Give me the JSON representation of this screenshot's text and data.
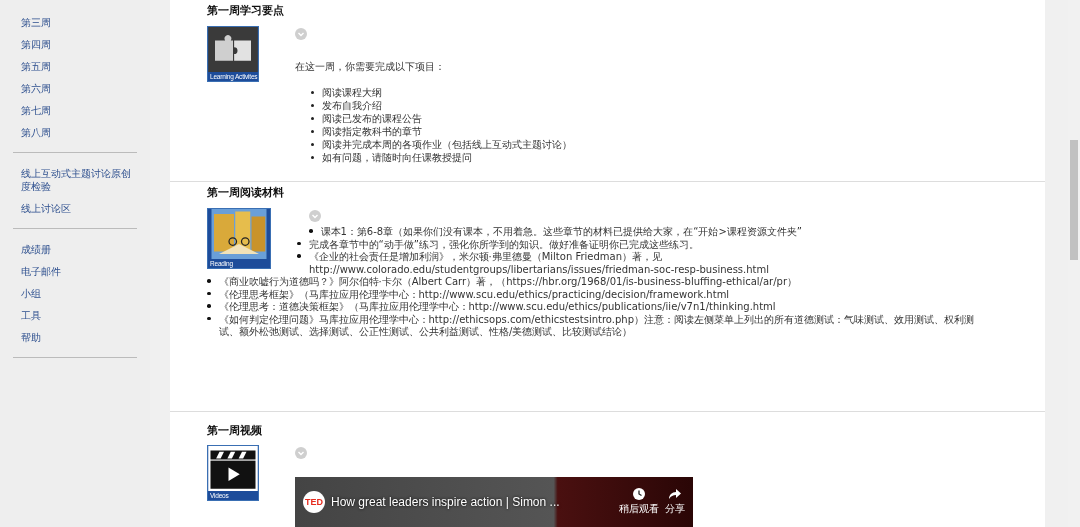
{
  "sidebar": {
    "groups": [
      {
        "items": [
          {
            "label": "第三周"
          },
          {
            "label": "第四周"
          },
          {
            "label": "第五周"
          },
          {
            "label": "第六周"
          },
          {
            "label": "第七周"
          },
          {
            "label": "第八周"
          }
        ]
      },
      {
        "items": [
          {
            "label": "线上互动式主题讨论原创度检验"
          },
          {
            "label": "线上讨论区"
          }
        ]
      },
      {
        "items": [
          {
            "label": "成绩册"
          },
          {
            "label": "电子邮件"
          },
          {
            "label": "小组"
          },
          {
            "label": "工具"
          },
          {
            "label": "帮助"
          }
        ]
      }
    ]
  },
  "sections": [
    {
      "kind": "activities",
      "title": "第一周学习要点",
      "image_label": "Learning Activites",
      "intro": "在这一周，你需要完成以下项目：",
      "items": [
        "阅读课程大纲",
        "发布自我介绍",
        "阅读已发布的课程公告",
        "阅读指定教科书的章节",
        "阅读并完成本周的各项作业（包括线上互动式主题讨论）",
        "如有问题，请随时向任课教授提问"
      ]
    },
    {
      "kind": "reading",
      "title": "第一周阅读材料",
      "image_label": "Reading",
      "items": [
        "课本1：第6-8章（如果你们没有课本，不用着急。这些章节的材料已提供给大家，在“开始>课程资源文件夹”",
        "完成各章节中的“动手做”练习，强化你所学到的知识。做好准备证明你已完成这些练习。",
        "《企业的社会责任是增加利润》，米尔顿·弗里德曼（Milton Friedman）著，见http://www.colorado.edu/studentgroups/libertarians/issues/friedman-soc-resp-business.html",
        "《商业吹嘘行为道德吗？》阿尔伯特·卡尔（Albert Carr）著，（https://hbr.org/1968/01/is-business-bluffing-ethical/ar/pr）",
        "《伦理思考框架》（马库拉应用伦理学中心：http://www.scu.edu/ethics/practicing/decision/framework.html",
        "《伦理思考：道德决策框架》（马库拉应用伦理学中心：http://www.scu.edu/ethics/publications/iie/v7n1/thinking.html",
        "《如何判定伦理问题》马库拉应用伦理学中心：http://ethicsops.com/ethicstestsintro.php）注意：阅读左侧菜单上列出的所有道德测试：气味测试、效用测试、权利测试、额外松弛测试、选择测试、公正性测试、公共利益测试、性格/美德测试、比较测试结论）"
      ]
    },
    {
      "kind": "video",
      "title": "第一周视频",
      "image_label": "Videos",
      "video": {
        "channel": "TED",
        "title": "How great leaders inspire action | Simon ...",
        "watch_later": "稍后观看",
        "share": "分享"
      }
    }
  ]
}
